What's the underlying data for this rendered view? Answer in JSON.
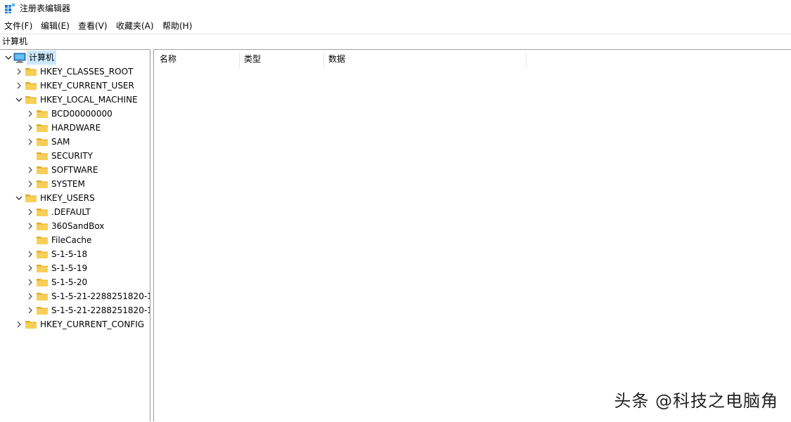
{
  "window": {
    "title": "注册表编辑器"
  },
  "menu": [
    {
      "label": "文件(F)"
    },
    {
      "label": "编辑(E)"
    },
    {
      "label": "查看(V)"
    },
    {
      "label": "收藏夹(A)"
    },
    {
      "label": "帮助(H)"
    }
  ],
  "address": {
    "path": "计算机"
  },
  "tree": {
    "root": "计算机",
    "nodes": [
      {
        "label": "HKEY_CLASSES_ROOT"
      },
      {
        "label": "HKEY_CURRENT_USER"
      },
      {
        "label": "HKEY_LOCAL_MACHINE"
      },
      {
        "label": "BCD00000000"
      },
      {
        "label": "HARDWARE"
      },
      {
        "label": "SAM"
      },
      {
        "label": "SECURITY"
      },
      {
        "label": "SOFTWARE"
      },
      {
        "label": "SYSTEM"
      },
      {
        "label": "HKEY_USERS"
      },
      {
        "label": ".DEFAULT"
      },
      {
        "label": "360SandBox"
      },
      {
        "label": "FileCache"
      },
      {
        "label": "S-1-5-18"
      },
      {
        "label": "S-1-5-19"
      },
      {
        "label": "S-1-5-20"
      },
      {
        "label": "S-1-5-21-2288251820-1"
      },
      {
        "label": "S-1-5-21-2288251820-1"
      },
      {
        "label": "HKEY_CURRENT_CONFIG"
      }
    ]
  },
  "list": {
    "columns": [
      "名称",
      "类型",
      "数据"
    ]
  },
  "watermark": "头条 @科技之电脑角",
  "colors": {
    "selection": "#cce8ff",
    "folder": "#f6cf57",
    "folder_dark": "#e3ab24",
    "computer": "#2f8fd8"
  }
}
